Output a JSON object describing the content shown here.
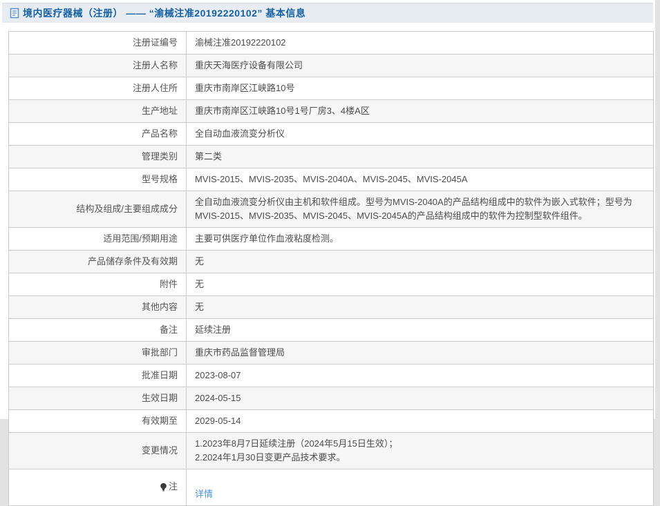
{
  "header": {
    "title": "境内医疗器械（注册） —— “渝械注准20192220102” 基本信息",
    "icon": "document-icon"
  },
  "table": {
    "rows": [
      {
        "label": "注册证编号",
        "value": "渝械注准20192220102"
      },
      {
        "label": "注册人名称",
        "value": "重庆天海医疗设备有限公司"
      },
      {
        "label": "注册人住所",
        "value": "重庆市南岸区江峡路10号"
      },
      {
        "label": "生产地址",
        "value": "重庆市南岸区江峡路10号1号厂房3、4楼A区"
      },
      {
        "label": "产品名称",
        "value": "全自动血液流变分析仪"
      },
      {
        "label": "管理类别",
        "value": "第二类"
      },
      {
        "label": "型号规格",
        "value": "MVIS-2015、MVIS-2035、MVIS-2040A、MVIS-2045、MVIS-2045A"
      },
      {
        "label": "结构及组成/主要组成成分",
        "value": "全自动血液流变分析仪由主机和软件组成。型号为MVIS-2040A的产品结构组成中的软件为嵌入式软件；型号为MVIS-2015、MVIS-2035、MVIS-2045、MVIS-2045A的产品结构组成中的软件为控制型软件组件。"
      },
      {
        "label": "适用范围/预期用途",
        "value": "主要可供医疗单位作血液粘度检测。"
      },
      {
        "label": "产品储存条件及有效期",
        "value": "无"
      },
      {
        "label": "附件",
        "value": "无"
      },
      {
        "label": "其他内容",
        "value": "无"
      },
      {
        "label": "备注",
        "value": "延续注册"
      },
      {
        "label": "审批部门",
        "value": "重庆市药品监督管理局"
      },
      {
        "label": "批准日期",
        "value": "2023-08-07"
      },
      {
        "label": "生效日期",
        "value": "2024-05-15"
      },
      {
        "label": "有效期至",
        "value": "2029-05-14"
      },
      {
        "label": "变更情况",
        "value": "1.2023年8月7日延续注册（2024年5月15日生效）；\n2.2024年1月30日变更产品技术要求。"
      }
    ],
    "note_row": {
      "label": "注",
      "icon": "lightbulb-icon",
      "link_text": "详情"
    }
  },
  "colors": {
    "accent_blue": "#1560a3",
    "link_blue": "#4a90d9",
    "row_alt": "#f6f6f6",
    "border": "#cbcbcb",
    "header_bg": "#e7ecf2"
  }
}
